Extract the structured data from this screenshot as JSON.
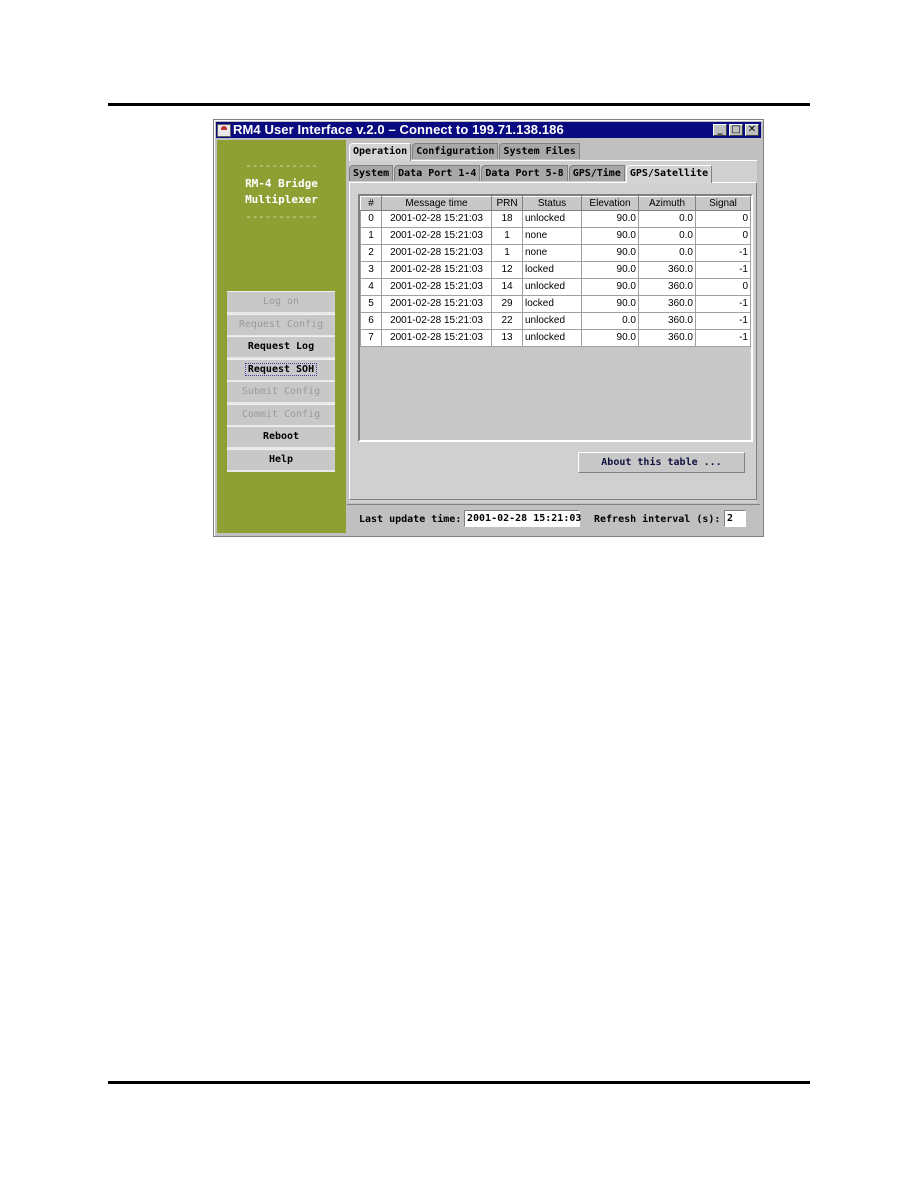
{
  "window": {
    "title": "RM4 User Interface v.2.0  – Connect to 199.71.138.186",
    "controls": {
      "minimize": "_",
      "maximize": "□",
      "close": "✕"
    }
  },
  "sidebar": {
    "dashes": "-----------",
    "brand_line1": "RM-4 Bridge",
    "brand_line2": "Multiplexer",
    "buttons": [
      {
        "label": "Log on",
        "enabled": false
      },
      {
        "label": "Request Config",
        "enabled": false
      },
      {
        "label": "Request Log",
        "enabled": true
      },
      {
        "label": "Request SOH",
        "enabled": true,
        "focused": true
      },
      {
        "label": "Submit Config",
        "enabled": false
      },
      {
        "label": "Commit Config",
        "enabled": false
      },
      {
        "label": "Reboot",
        "enabled": true
      },
      {
        "label": "Help",
        "enabled": true
      }
    ]
  },
  "tabs": {
    "outer": [
      {
        "label": "Operation",
        "active": true
      },
      {
        "label": "Configuration",
        "active": false
      },
      {
        "label": "System Files",
        "active": false
      }
    ],
    "inner": [
      {
        "label": "System",
        "active": false
      },
      {
        "label": "Data Port 1-4",
        "active": false
      },
      {
        "label": "Data Port 5-8",
        "active": false
      },
      {
        "label": "GPS/Time",
        "active": false
      },
      {
        "label": "GPS/Satellite",
        "active": true
      }
    ]
  },
  "table": {
    "columns": [
      "#",
      "Message time",
      "PRN",
      "Status",
      "Elevation",
      "Azimuth",
      "Signal"
    ],
    "rows": [
      [
        "0",
        "2001-02-28 15:21:03",
        "18",
        "unlocked",
        "90.0",
        "0.0",
        "0"
      ],
      [
        "1",
        "2001-02-28 15:21:03",
        "1",
        "none",
        "90.0",
        "0.0",
        "0"
      ],
      [
        "2",
        "2001-02-28 15:21:03",
        "1",
        "none",
        "90.0",
        "0.0",
        "-1"
      ],
      [
        "3",
        "2001-02-28 15:21:03",
        "12",
        "locked",
        "90.0",
        "360.0",
        "-1"
      ],
      [
        "4",
        "2001-02-28 15:21:03",
        "14",
        "unlocked",
        "90.0",
        "360.0",
        "0"
      ],
      [
        "5",
        "2001-02-28 15:21:03",
        "29",
        "locked",
        "90.0",
        "360.0",
        "-1"
      ],
      [
        "6",
        "2001-02-28 15:21:03",
        "22",
        "unlocked",
        "0.0",
        "360.0",
        "-1"
      ],
      [
        "7",
        "2001-02-28 15:21:03",
        "13",
        "unlocked",
        "90.0",
        "360.0",
        "-1"
      ]
    ]
  },
  "about_button": "About this table ...",
  "status": {
    "last_update_label": "Last update time:",
    "last_update_value": "2001-02-28 15:21:03",
    "refresh_label": "Refresh interval (s):",
    "refresh_value": "2"
  }
}
